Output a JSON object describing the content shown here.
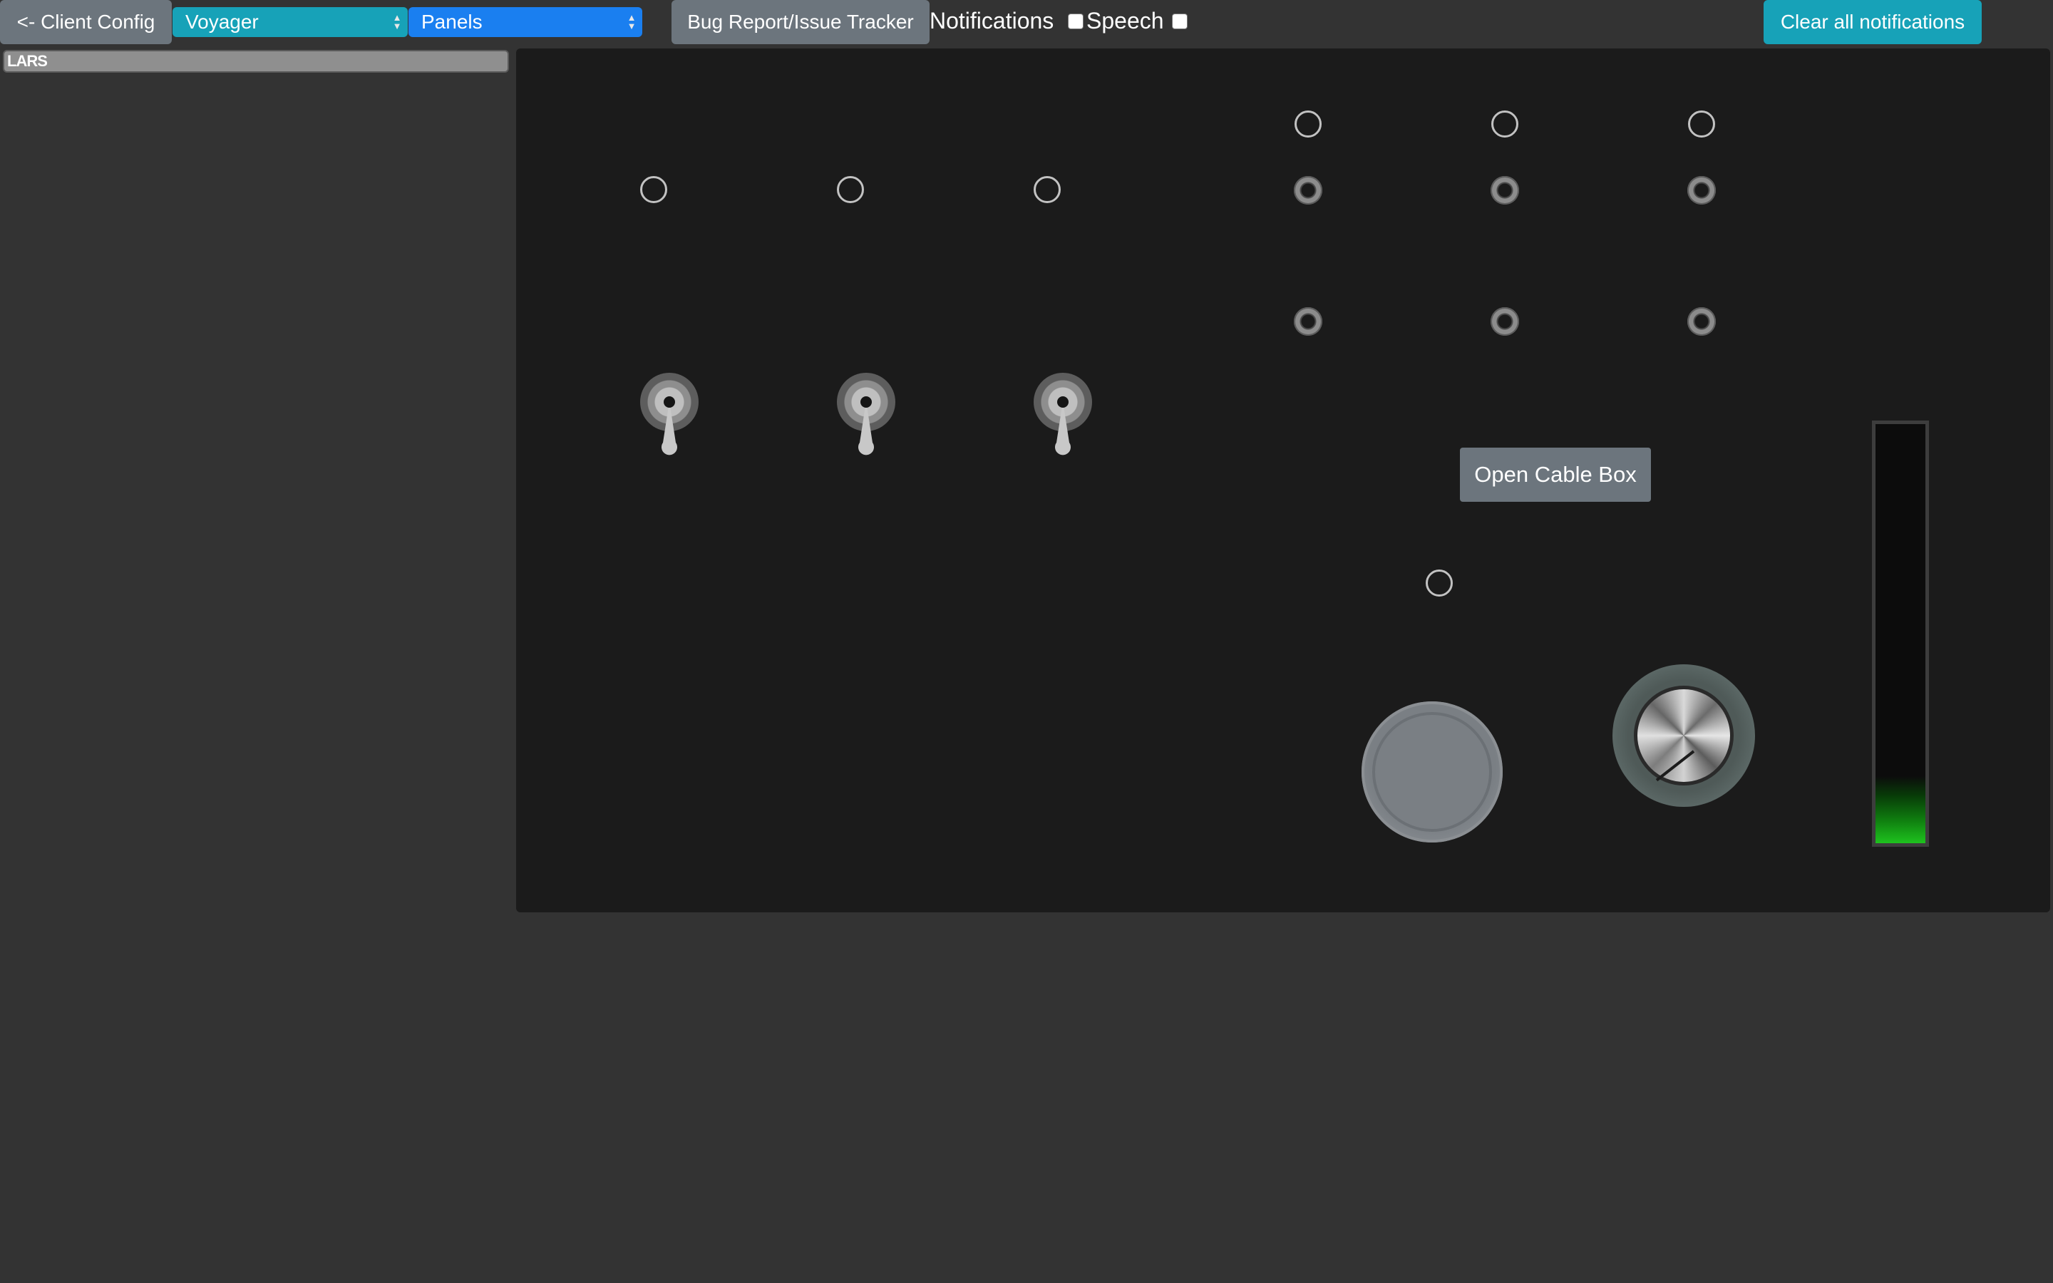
{
  "toolbar": {
    "back_label": "<- Client Config",
    "simulator_select": "Voyager",
    "view_select": "Panels",
    "bug_report_label": "Bug Report/Issue Tracker",
    "notifications_label": "Notifications",
    "notifications_checked": false,
    "speech_label": "Speech",
    "speech_checked": false,
    "clear_label": "Clear all notifications"
  },
  "sidebar": {
    "items": [
      {
        "label": "LARS"
      }
    ]
  },
  "panel": {
    "cable_box_label": "Open Cable Box",
    "toggle_switches": [
      "down",
      "down",
      "down"
    ],
    "meter_level": 0.16
  },
  "colors": {
    "background": "#333333",
    "panel": "#1b1b1b",
    "secondary_button": "#6c757d",
    "info_button": "#17a2b8",
    "primary_select": "#1a7ff0",
    "meter_green": "#1ec21e"
  }
}
